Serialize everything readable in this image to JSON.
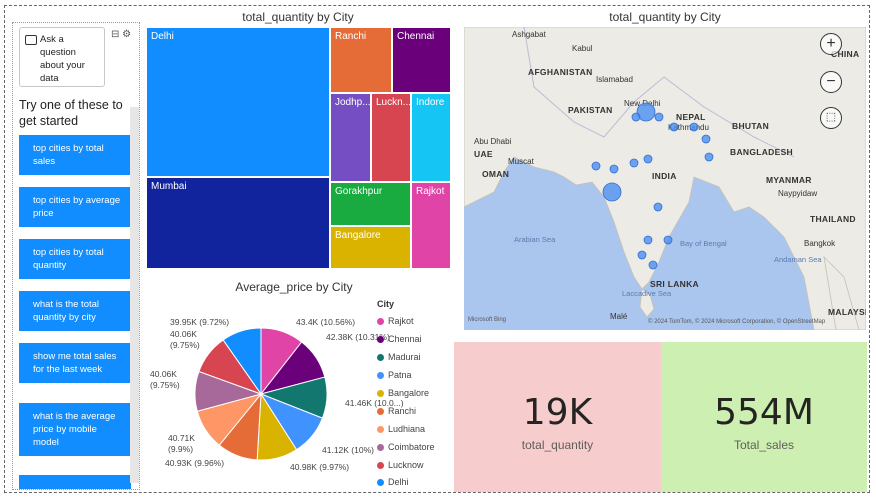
{
  "qa": {
    "ask_text": "Ask a question about your data",
    "intro": "Try one of these to get started",
    "suggestions": [
      "top cities by total sales",
      "top cities by average price",
      "top cities by total quantity",
      "what is the total quantity by city",
      "show me total sales for the last week",
      "what is the average price by mobile model"
    ]
  },
  "treemap": {
    "title": "total_quantity by City",
    "cells": [
      "Delhi",
      "Mumbai",
      "Ranchi",
      "Chennai",
      "Jodhp...",
      "Luckn...",
      "Indore",
      "Gorakhpur",
      "Rajkot",
      "Bangalore"
    ]
  },
  "map": {
    "title": "total_quantity by City",
    "labels": {
      "ashgabat": "Ashgabat",
      "kabul": "Kabul",
      "china": "CHINA",
      "afghanistan": "AFGHANISTAN",
      "islamabad": "Islamabad",
      "pakistan": "PAKISTAN",
      "newdelhi": "New Delhi",
      "nepal": "NEPAL",
      "kathmandu": "Kathmandu",
      "bhutan": "BHUTAN",
      "abudhabi": "Abu Dhabi",
      "muscat": "Muscat",
      "uae": "UAE",
      "oman": "OMAN",
      "bangladesh": "BANGLADESH",
      "india": "INDIA",
      "myanmar": "MYANMAR",
      "naypyidaw": "Naypyidaw",
      "thailand": "THAILAND",
      "arabiansea": "Arabian Sea",
      "bayofbengal": "Bay of Bengal",
      "bangkok": "Bangkok",
      "srilanka": "SRI LANKA",
      "andaman": "Andaman Sea",
      "laccadive": "Laccadive Sea",
      "male": "Malé",
      "malaysia": "MALAYSIA",
      "attribution": "© 2024 TomTom, © 2024 Microsoft Corporation, © OpenStreetMap",
      "bing": "Microsoft Bing"
    }
  },
  "pie": {
    "title": "Average_price by City",
    "legend_title": "City",
    "legend": [
      "Rajkot",
      "Chennai",
      "Madurai",
      "Patna",
      "Bangalore",
      "Ranchi",
      "Ludhiana",
      "Coimbatore",
      "Lucknow",
      "Delhi"
    ],
    "labels": [
      "43.4K (10.56%)",
      "42.38K (10.31%)",
      "41.46K (10.0...)",
      "41.12K (10%)",
      "40.98K (9.97%)",
      "40.93K (9.96%)",
      "40.71K (9.9%)",
      "40.06K (9.75%)",
      "40.06K (9.75%)",
      "39.95K (9.72%)"
    ]
  },
  "cards": {
    "quantity_value": "19K",
    "quantity_label": "total_quantity",
    "sales_value": "554M",
    "sales_label": "Total_sales"
  },
  "chart_data": [
    {
      "type": "treemap",
      "title": "total_quantity by City",
      "categories": [
        "Delhi",
        "Mumbai",
        "Ranchi",
        "Chennai",
        "Jodhp...",
        "Luckn...",
        "Indore",
        "Gorakhpur",
        "Rajkot",
        "Bangalore"
      ]
    },
    {
      "type": "pie",
      "title": "Average_price by City",
      "categories": [
        "Rajkot",
        "Chennai",
        "Madurai",
        "Patna",
        "Bangalore",
        "Ranchi",
        "Ludhiana",
        "Coimbatore",
        "Lucknow",
        "Delhi"
      ],
      "values": [
        43400,
        42380,
        41460,
        41120,
        40980,
        40930,
        40710,
        40060,
        40060,
        39950
      ],
      "percents": [
        10.56,
        10.31,
        10.0,
        10.0,
        9.97,
        9.96,
        9.9,
        9.75,
        9.75,
        9.72
      ],
      "colors": [
        "#e044a7",
        "#6b007b",
        "#12776f",
        "#4092ff",
        "#d9b300",
        "#e66c37",
        "#fe9666",
        "#a66999",
        "#d64550",
        "#118dff"
      ]
    }
  ]
}
